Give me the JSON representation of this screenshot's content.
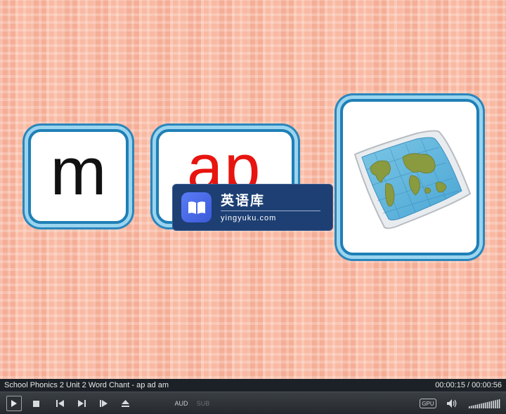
{
  "video": {
    "card_left_letter": "m",
    "card_mid_letters": "ap",
    "card_right_image": "world-map-picture"
  },
  "watermark": {
    "title": "英语库",
    "url": "yingyuku.com",
    "logo_icon": "book-icon"
  },
  "infobar": {
    "title": "School Phonics 2 Unit 2 Word Chant - ap ad am",
    "time": "00:00:15 / 00:00:56"
  },
  "controls": {
    "aud_label": "AUD",
    "sub_label": "SUB",
    "gpu_label": "GPU",
    "volume_level": 1.0
  },
  "colors": {
    "card_border": "#1f7fb6",
    "card_glow": "#9ad4ee",
    "letters_red": "#e8140f",
    "watermark_bg": "#1d3f73"
  }
}
